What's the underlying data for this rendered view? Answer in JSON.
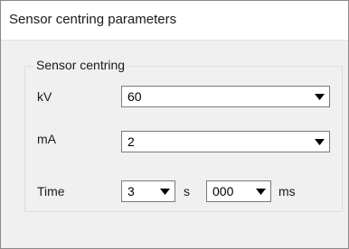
{
  "window": {
    "title": "Sensor centring parameters"
  },
  "group": {
    "legend": "Sensor centring"
  },
  "fields": {
    "kv": {
      "label": "kV",
      "value": "60"
    },
    "ma": {
      "label": "mA",
      "value": "2"
    },
    "time": {
      "label": "Time",
      "seconds_value": "3",
      "seconds_unit": "s",
      "ms_value": "000",
      "ms_unit": "ms"
    }
  },
  "icons": {
    "dropdown": "chevron-down-icon"
  }
}
